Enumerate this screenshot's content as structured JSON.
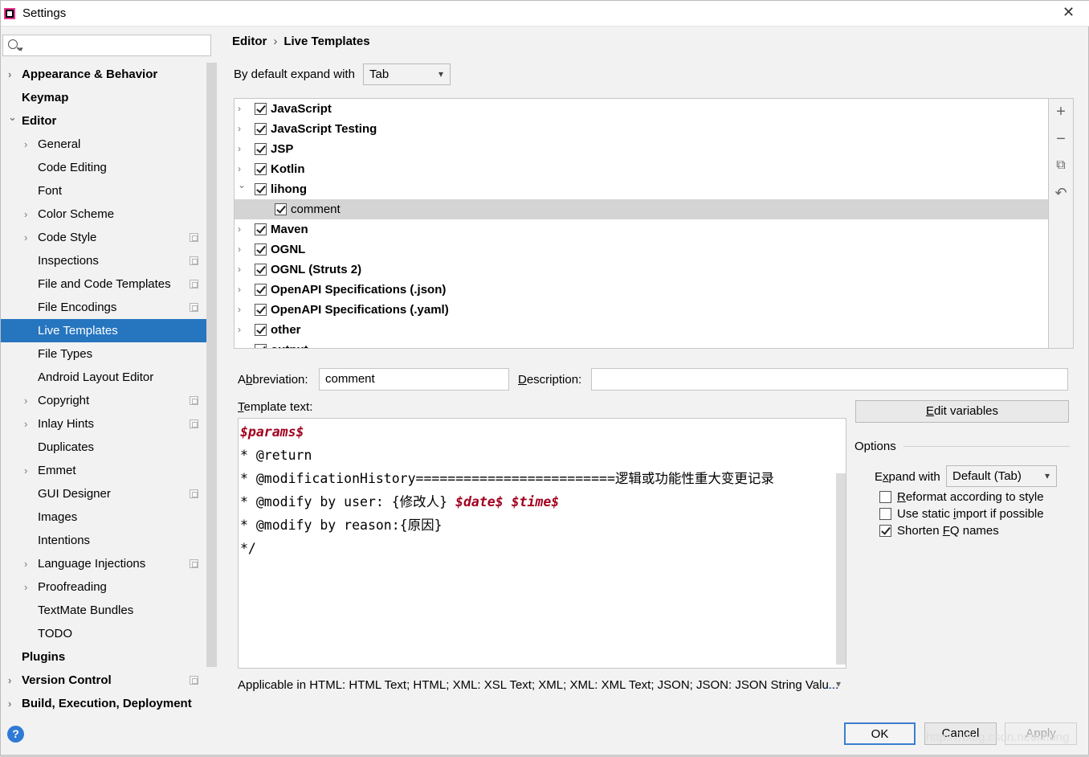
{
  "window": {
    "title": "Settings",
    "close": "✕"
  },
  "search": {
    "placeholder": ""
  },
  "sidebar": {
    "items": [
      {
        "label": "Appearance & Behavior",
        "bold": true,
        "chev": "›",
        "level": 0,
        "page": false
      },
      {
        "label": "Keymap",
        "bold": true,
        "chev": "",
        "level": 0,
        "page": false
      },
      {
        "label": "Editor",
        "bold": true,
        "chev": "⌄",
        "level": 0,
        "page": false
      },
      {
        "label": "General",
        "bold": false,
        "chev": "›",
        "level": 1,
        "page": false
      },
      {
        "label": "Code Editing",
        "bold": false,
        "chev": "",
        "level": 1,
        "page": false
      },
      {
        "label": "Font",
        "bold": false,
        "chev": "",
        "level": 1,
        "page": false
      },
      {
        "label": "Color Scheme",
        "bold": false,
        "chev": "›",
        "level": 1,
        "page": false
      },
      {
        "label": "Code Style",
        "bold": false,
        "chev": "›",
        "level": 1,
        "page": true
      },
      {
        "label": "Inspections",
        "bold": false,
        "chev": "",
        "level": 1,
        "page": true
      },
      {
        "label": "File and Code Templates",
        "bold": false,
        "chev": "",
        "level": 1,
        "page": true
      },
      {
        "label": "File Encodings",
        "bold": false,
        "chev": "",
        "level": 1,
        "page": true
      },
      {
        "label": "Live Templates",
        "bold": false,
        "chev": "",
        "level": 1,
        "page": false,
        "selected": true
      },
      {
        "label": "File Types",
        "bold": false,
        "chev": "",
        "level": 1,
        "page": false
      },
      {
        "label": "Android Layout Editor",
        "bold": false,
        "chev": "",
        "level": 1,
        "page": false
      },
      {
        "label": "Copyright",
        "bold": false,
        "chev": "›",
        "level": 1,
        "page": true
      },
      {
        "label": "Inlay Hints",
        "bold": false,
        "chev": "›",
        "level": 1,
        "page": true
      },
      {
        "label": "Duplicates",
        "bold": false,
        "chev": "",
        "level": 1,
        "page": false
      },
      {
        "label": "Emmet",
        "bold": false,
        "chev": "›",
        "level": 1,
        "page": false
      },
      {
        "label": "GUI Designer",
        "bold": false,
        "chev": "",
        "level": 1,
        "page": true
      },
      {
        "label": "Images",
        "bold": false,
        "chev": "",
        "level": 1,
        "page": false
      },
      {
        "label": "Intentions",
        "bold": false,
        "chev": "",
        "level": 1,
        "page": false
      },
      {
        "label": "Language Injections",
        "bold": false,
        "chev": "›",
        "level": 1,
        "page": true
      },
      {
        "label": "Proofreading",
        "bold": false,
        "chev": "›",
        "level": 1,
        "page": false
      },
      {
        "label": "TextMate Bundles",
        "bold": false,
        "chev": "",
        "level": 1,
        "page": false
      },
      {
        "label": "TODO",
        "bold": false,
        "chev": "",
        "level": 1,
        "page": false
      },
      {
        "label": "Plugins",
        "bold": true,
        "chev": "",
        "level": 0,
        "page": false
      },
      {
        "label": "Version Control",
        "bold": true,
        "chev": "›",
        "level": 0,
        "page": true
      },
      {
        "label": "Build, Execution, Deployment",
        "bold": true,
        "chev": "›",
        "level": 0,
        "page": false
      }
    ]
  },
  "breadcrumb": {
    "parent": "Editor",
    "sep": "›",
    "current": "Live Templates"
  },
  "expand_default": {
    "label": "By default expand with",
    "value": "Tab"
  },
  "tree": {
    "rows": [
      {
        "label": "JavaScript",
        "chev": "›",
        "checked": true,
        "child": false
      },
      {
        "label": "JavaScript Testing",
        "chev": "›",
        "checked": true,
        "child": false
      },
      {
        "label": "JSP",
        "chev": "›",
        "checked": true,
        "child": false
      },
      {
        "label": "Kotlin",
        "chev": "›",
        "checked": true,
        "child": false
      },
      {
        "label": "lihong",
        "chev": "⌄",
        "checked": true,
        "child": false
      },
      {
        "label": "comment",
        "chev": "",
        "checked": true,
        "child": true,
        "selected": true
      },
      {
        "label": "Maven",
        "chev": "›",
        "checked": true,
        "child": false
      },
      {
        "label": "OGNL",
        "chev": "›",
        "checked": true,
        "child": false
      },
      {
        "label": "OGNL (Struts 2)",
        "chev": "›",
        "checked": true,
        "child": false
      },
      {
        "label": "OpenAPI Specifications (.json)",
        "chev": "›",
        "checked": true,
        "child": false
      },
      {
        "label": "OpenAPI Specifications (.yaml)",
        "chev": "›",
        "checked": true,
        "child": false
      },
      {
        "label": "other",
        "chev": "›",
        "checked": true,
        "child": false
      },
      {
        "label": "output",
        "chev": "›",
        "checked": true,
        "child": false
      }
    ]
  },
  "tools": {
    "add": "+",
    "remove": "−",
    "copy": "⧉",
    "restore": "↶"
  },
  "abbreviation": {
    "label_pre": "A",
    "label_u": "b",
    "label_post": "breviation:",
    "value": "comment"
  },
  "description": {
    "label_u": "D",
    "label_post": "escription:",
    "value": ""
  },
  "template_text": {
    "label_u": "T",
    "label_post": "emplate text:",
    "lines": [
      [
        {
          "t": "$params$",
          "v": true
        }
      ],
      [
        {
          "t": "* @return",
          "v": false
        }
      ],
      [
        {
          "t": "* @modificationHistory=========================逻辑或功能性重大变更记录",
          "v": false
        }
      ],
      [
        {
          "t": "* @modify by user: {修改人} ",
          "v": false
        },
        {
          "t": "$date$",
          "v": true
        },
        {
          "t": " ",
          "v": false
        },
        {
          "t": "$time$",
          "v": true
        }
      ],
      [
        {
          "t": "* @modify by reason:{原因}",
          "v": false
        }
      ],
      [
        {
          "t": "*/",
          "v": false
        }
      ]
    ]
  },
  "edit_variables": {
    "label_u": "E",
    "label_post": "dit variables"
  },
  "options": {
    "title": "Options",
    "expand_label_pre": "E",
    "expand_label_u": "x",
    "expand_label_post": "pand with",
    "expand_value": "Default (Tab)",
    "checks": [
      {
        "pre": "",
        "u": "R",
        "post": "eformat according to style",
        "checked": false
      },
      {
        "pre": "Use static ",
        "u": "i",
        "post": "mport if possible",
        "checked": false
      },
      {
        "pre": "Shorten ",
        "u": "F",
        "post": "Q names",
        "checked": true
      }
    ]
  },
  "applicable": {
    "text": "Applicable in HTML: HTML Text; HTML; XML: XSL Text; XML; XML: XML Text; JSON; JSON: JSON String Valu...",
    "more": "..."
  },
  "buttons": {
    "ok": "OK",
    "cancel": "Cancel",
    "apply": "Apply",
    "help": "?"
  },
  "watermark": "https://blog.csdn.net/lihong"
}
